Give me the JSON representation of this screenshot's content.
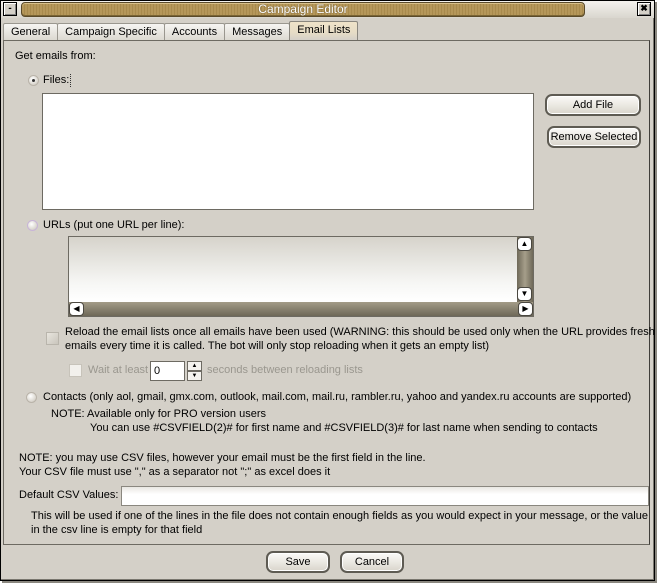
{
  "window": {
    "title": "Campaign Editor",
    "minimize_icon": "minus-icon",
    "close_icon": "close-x-icon"
  },
  "tabs": [
    {
      "label": "General",
      "active": false
    },
    {
      "label": "Campaign Specific",
      "active": false
    },
    {
      "label": "Accounts",
      "active": false
    },
    {
      "label": "Messages",
      "active": false
    },
    {
      "label": "Email Lists",
      "active": true
    }
  ],
  "email_lists": {
    "source_label": "Get emails from:",
    "files": {
      "label": "Files:",
      "selected": true,
      "items": [],
      "add_button": "Add File",
      "remove_button": "Remove Selected"
    },
    "urls": {
      "label": "URLs (put one URL per line):",
      "selected": false,
      "value": ""
    },
    "reload": {
      "checked": false,
      "line1": "Reload the email lists once all emails have been used (WARNING: this should be used only when the URL provides fresh",
      "line2": "emails every time it is called. The bot will only stop reloading when it gets an empty list)"
    },
    "wait": {
      "checked": false,
      "label_before": "Wait at least",
      "value": "0",
      "label_after": "seconds between reloading lists"
    },
    "contacts": {
      "label": "Contacts (only aol, gmail, gmx.com, outlook, mail.com, mail.ru, rambler.ru, yahoo and yandex.ru accounts are supported)",
      "selected": false,
      "note1": "NOTE:  Available only for PRO version users",
      "note2": "You can use #CSVFIELD(2)# for first name and #CSVFIELD(3)# for last name when sending to contacts"
    },
    "csv_note1": "NOTE: you may use CSV files, however your email must be the first field in the line.",
    "csv_note2": "Your CSV file must use \",\" as a separator not \";\" as excel does it",
    "default_csv": {
      "label": "Default CSV Values:",
      "value": ""
    },
    "default_note1": "This will be used if one of the lines in the file does not contain enough fields as you would expect in your message, or the value",
    "default_note2": "in the csv line is empty for that field"
  },
  "footer": {
    "save": "Save",
    "cancel": "Cancel"
  },
  "icons": {
    "scroll_up": "▲",
    "scroll_down": "▼",
    "scroll_left": "◀",
    "scroll_right": "▶",
    "minimize": "-",
    "close": "✖"
  }
}
